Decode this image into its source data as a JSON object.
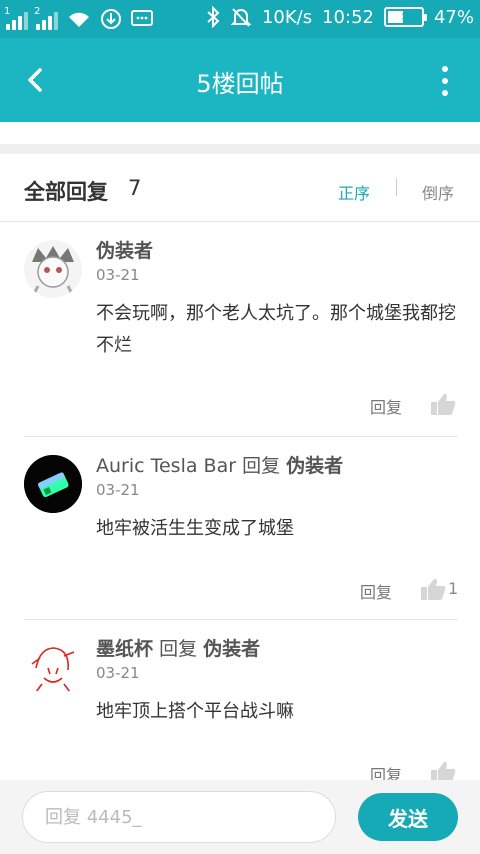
{
  "status_bar": {
    "sim1": "1",
    "sim2": "2",
    "net_speed": "10K/s",
    "time": "10:52",
    "battery": "47%",
    "battery_level": 0.47
  },
  "title_bar": {
    "title": "5楼回帖"
  },
  "header": {
    "title": "全部回复",
    "count": "7",
    "sort_asc": "正序",
    "sort_desc": "倒序"
  },
  "replies": [
    {
      "author": "伪装者",
      "reply_word": "",
      "reply_to": "",
      "date": "03-21",
      "text": "不会玩啊，那个老人太坑了。那个城堡我都挖不烂",
      "reply_label": "回复",
      "likes": ""
    },
    {
      "author": "Auric Tesla Bar",
      "reply_word": "回复",
      "reply_to": "伪装者",
      "date": "03-21",
      "text": "地牢被活生生变成了城堡",
      "reply_label": "回复",
      "likes": "1"
    },
    {
      "author": "墨纸杯",
      "reply_word": "回复",
      "reply_to": "伪装者",
      "date": "03-21",
      "text": "地牢顶上搭个平台战斗嘛",
      "reply_label": "回复",
      "likes": ""
    }
  ],
  "input": {
    "placeholder": "回复 4445_",
    "send_label": "发送"
  },
  "colors": {
    "accent": "#16aab7",
    "titlebar": "#1bb6c1"
  }
}
